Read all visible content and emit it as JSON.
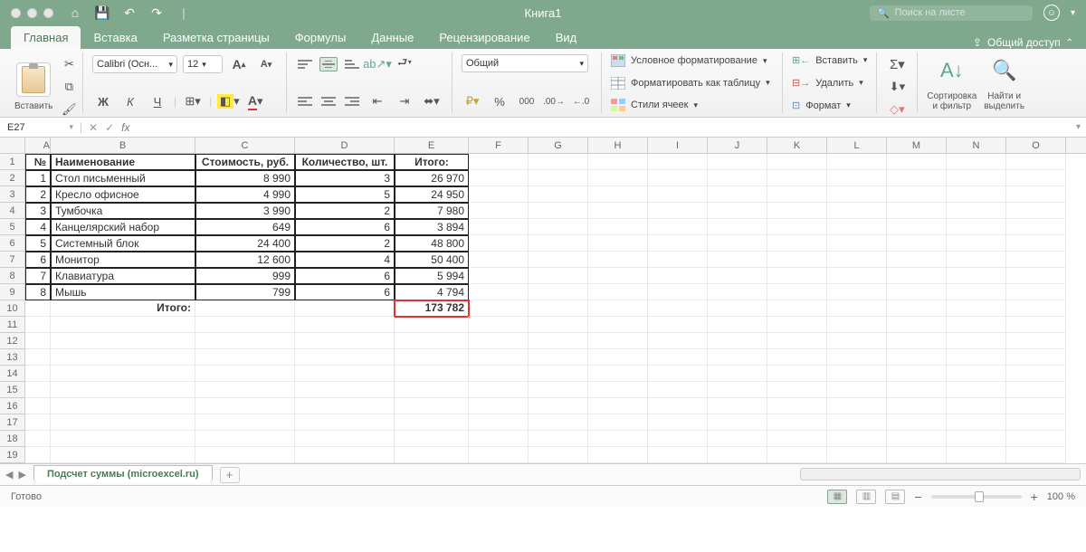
{
  "titlebar": {
    "title": "Книга1",
    "search_placeholder": "Поиск на листе"
  },
  "tabs": {
    "items": [
      "Главная",
      "Вставка",
      "Разметка страницы",
      "Формулы",
      "Данные",
      "Рецензирование",
      "Вид"
    ],
    "active": 0,
    "share": "Общий доступ"
  },
  "ribbon": {
    "paste": "Вставить",
    "font_name": "Calibri (Осн...",
    "font_size": "12",
    "bold": "Ж",
    "italic": "К",
    "under": "Ч",
    "number_format": "Общий",
    "cond_format": "Условное форматирование",
    "format_table": "Форматировать как таблицу",
    "cell_styles": "Стили ячеек",
    "insert": "Вставить",
    "delete": "Удалить",
    "format": "Формат",
    "sort": "Сортировка\nи фильтр",
    "find": "Найти и\nвыделить"
  },
  "formula": {
    "namebox": "E27",
    "fx": "fx",
    "value": ""
  },
  "columns": [
    "A",
    "B",
    "C",
    "D",
    "E",
    "F",
    "G",
    "H",
    "I",
    "J",
    "K",
    "L",
    "M",
    "N",
    "O"
  ],
  "headers": {
    "A": "№",
    "B": "Наименование",
    "C": "Стоимость, руб.",
    "D": "Количество, шт.",
    "E": "Итого:"
  },
  "rows": [
    {
      "n": "1",
      "name": "Стол письменный",
      "cost": "8 990",
      "qty": "3",
      "total": "26 970"
    },
    {
      "n": "2",
      "name": "Кресло офисное",
      "cost": "4 990",
      "qty": "5",
      "total": "24 950"
    },
    {
      "n": "3",
      "name": "Тумбочка",
      "cost": "3 990",
      "qty": "2",
      "total": "7 980"
    },
    {
      "n": "4",
      "name": "Канцелярский набор",
      "cost": "649",
      "qty": "6",
      "total": "3 894"
    },
    {
      "n": "5",
      "name": "Системный блок",
      "cost": "24 400",
      "qty": "2",
      "total": "48 800"
    },
    {
      "n": "6",
      "name": "Монитор",
      "cost": "12 600",
      "qty": "4",
      "total": "50 400"
    },
    {
      "n": "7",
      "name": "Клавиатура",
      "cost": "999",
      "qty": "6",
      "total": "5 994"
    },
    {
      "n": "8",
      "name": "Мышь",
      "cost": "799",
      "qty": "6",
      "total": "4 794"
    }
  ],
  "footer": {
    "label": "Итого:",
    "total": "173 782"
  },
  "sheet": {
    "name": "Подсчет суммы (microexcel.ru)"
  },
  "status": {
    "ready": "Готово",
    "zoom": "100 %",
    "minus": "−",
    "plus": "+"
  },
  "chart_data": {
    "type": "table",
    "title": "Итого",
    "columns": [
      "№",
      "Наименование",
      "Стоимость, руб.",
      "Количество, шт.",
      "Итого:"
    ],
    "data": [
      [
        1,
        "Стол письменный",
        8990,
        3,
        26970
      ],
      [
        2,
        "Кресло офисное",
        4990,
        5,
        24950
      ],
      [
        3,
        "Тумбочка",
        3990,
        2,
        7980
      ],
      [
        4,
        "Канцелярский набор",
        649,
        6,
        3894
      ],
      [
        5,
        "Системный блок",
        24400,
        2,
        48800
      ],
      [
        6,
        "Монитор",
        12600,
        4,
        50400
      ],
      [
        7,
        "Клавиатура",
        999,
        6,
        5994
      ],
      [
        8,
        "Мышь",
        799,
        6,
        4794
      ]
    ],
    "grand_total": 173782
  }
}
